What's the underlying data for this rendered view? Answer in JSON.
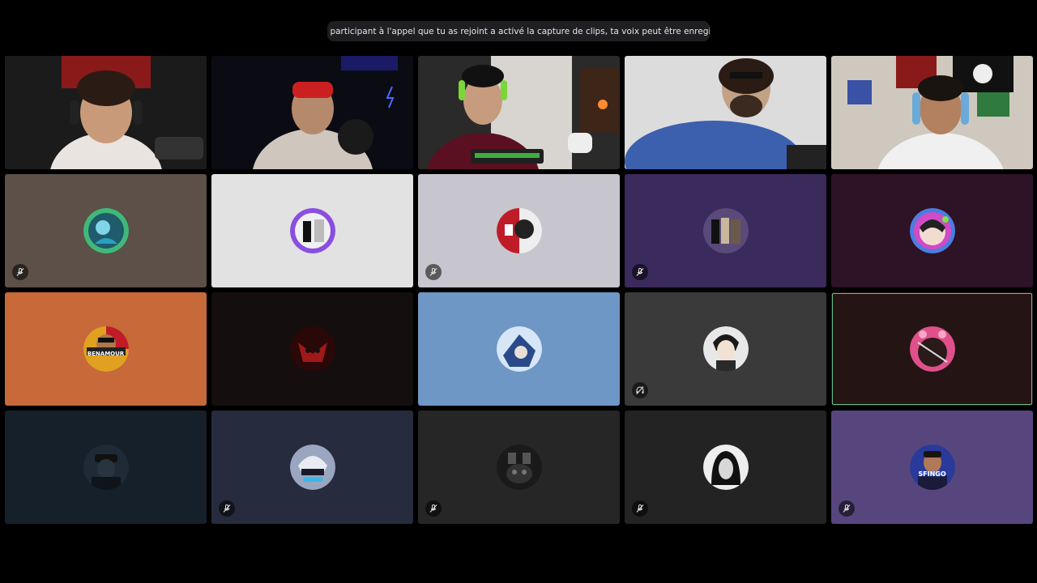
{
  "notification": {
    "icon": "clip-capture-icon",
    "text": "Un participant à l'appel que tu as rejoint a activé la capture de clips, ta voix peut être enregistrée."
  },
  "participants": [
    {
      "slot": 1,
      "kind": "video",
      "speaking": true,
      "muted": false,
      "bg": "#1a1a1a",
      "avatar_label": ""
    },
    {
      "slot": 2,
      "kind": "video",
      "speaking": false,
      "muted": false,
      "bg": "#0d0d1a",
      "avatar_label": ""
    },
    {
      "slot": 3,
      "kind": "video",
      "speaking": false,
      "muted": false,
      "bg": "#2a2a2a",
      "avatar_label": ""
    },
    {
      "slot": 4,
      "kind": "video",
      "speaking": false,
      "muted": false,
      "bg": "#d9d9d9",
      "avatar_label": ""
    },
    {
      "slot": 5,
      "kind": "video",
      "speaking": false,
      "muted": false,
      "bg": "#3a3a3a",
      "avatar_label": ""
    },
    {
      "slot": 6,
      "kind": "avatar",
      "speaking": false,
      "muted": true,
      "bg": "#5c5048",
      "avatar_label": ""
    },
    {
      "slot": 7,
      "kind": "avatar",
      "speaking": false,
      "muted": false,
      "bg": "#e2e2e2",
      "avatar_label": ""
    },
    {
      "slot": 8,
      "kind": "avatar",
      "speaking": false,
      "muted": true,
      "bg": "#c7c5cd",
      "avatar_label": ""
    },
    {
      "slot": 9,
      "kind": "avatar",
      "speaking": false,
      "muted": true,
      "bg": "#3b2a5c",
      "avatar_label": ""
    },
    {
      "slot": 10,
      "kind": "avatar",
      "speaking": false,
      "muted": false,
      "bg": "#2e1226",
      "avatar_label": ""
    },
    {
      "slot": 11,
      "kind": "avatar",
      "speaking": false,
      "muted": false,
      "bg": "#c8693a",
      "avatar_label": "BENAMOUR"
    },
    {
      "slot": 12,
      "kind": "avatar",
      "speaking": false,
      "muted": false,
      "bg": "#140e0e",
      "avatar_label": ""
    },
    {
      "slot": 13,
      "kind": "avatar",
      "speaking": false,
      "muted": false,
      "bg": "#6f97c6",
      "avatar_label": ""
    },
    {
      "slot": 14,
      "kind": "avatar",
      "speaking": false,
      "muted": "deafened",
      "bg": "#3a3a3a",
      "avatar_label": ""
    },
    {
      "slot": 15,
      "kind": "avatar",
      "speaking": true,
      "muted": false,
      "bg": "#241414",
      "avatar_label": ""
    },
    {
      "slot": 16,
      "kind": "avatar",
      "speaking": false,
      "muted": false,
      "bg": "#16202a",
      "avatar_label": ""
    },
    {
      "slot": 17,
      "kind": "avatar",
      "speaking": false,
      "muted": true,
      "bg": "#262b3d",
      "avatar_label": ""
    },
    {
      "slot": 18,
      "kind": "avatar",
      "speaking": false,
      "muted": true,
      "bg": "#262626",
      "avatar_label": ""
    },
    {
      "slot": 19,
      "kind": "avatar",
      "speaking": false,
      "muted": true,
      "bg": "#232323",
      "avatar_label": ""
    },
    {
      "slot": 20,
      "kind": "avatar",
      "speaking": false,
      "muted": true,
      "bg": "#57467e",
      "avatar_label": "SFINGO"
    }
  ],
  "colors": {
    "speaking_ring": "#3ba55d",
    "banner_bg": "#1f1f22"
  }
}
